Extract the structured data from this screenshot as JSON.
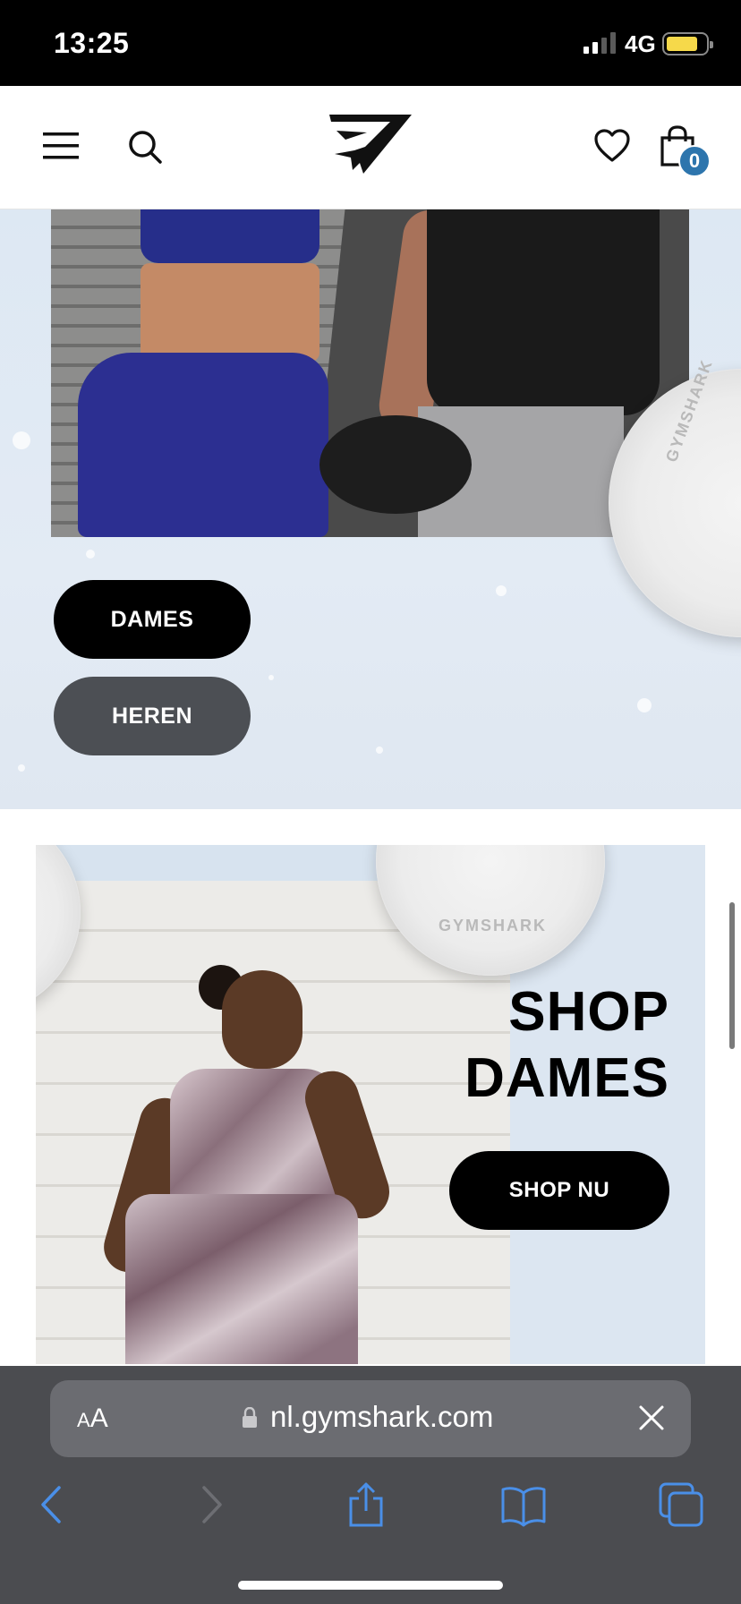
{
  "status_bar": {
    "time": "13:25",
    "network": "4G",
    "battery_level": 0.82,
    "signal_bars": 2,
    "colors": {
      "battery": "#f6d94a"
    }
  },
  "header": {
    "icons": [
      "menu-icon",
      "search-icon",
      "gymshark-logo",
      "heart-icon",
      "bag-icon"
    ],
    "cart_count": "0",
    "colors": {
      "badge": "#2d75ad"
    }
  },
  "hero": {
    "plate_label": "GYMSHARK",
    "buttons": {
      "dames": "DAMES",
      "heren": "HEREN"
    }
  },
  "promo": {
    "title_line1": "SHOP",
    "title_line2": "DAMES",
    "cta": "SHOP NU",
    "plate_label": "GYMSHARK"
  },
  "browser": {
    "text_size_label_small": "A",
    "text_size_label_large": "A",
    "url": "nl.gymshark.com",
    "toolbar": [
      "back-icon",
      "forward-icon",
      "share-icon",
      "bookmarks-icon",
      "tabs-icon"
    ],
    "colors": {
      "accent": "#4a8fe8"
    }
  }
}
